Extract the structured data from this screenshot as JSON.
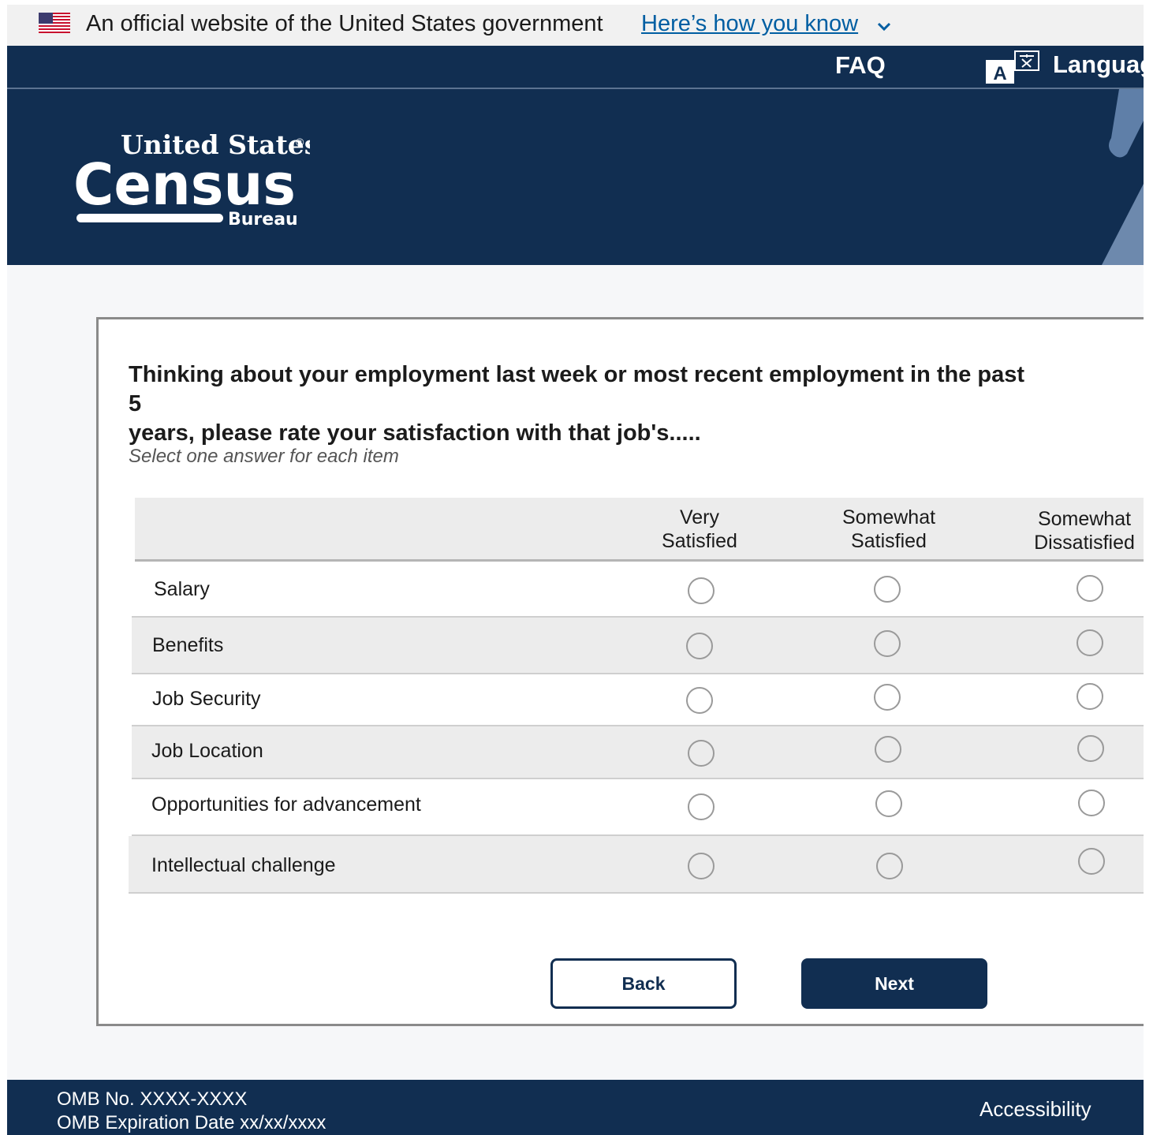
{
  "gov_banner": {
    "text": "An official website of the United States government",
    "link": "Here’s how you know"
  },
  "nav": {
    "faq": "FAQ",
    "language": "Language",
    "language_icon_letter": "A"
  },
  "logo": {
    "line1": "United States",
    "registered": "®",
    "line2": "Census",
    "line3": "Bureau"
  },
  "colors": {
    "navy": "#112e51",
    "link": "#005ea2",
    "row_alt": "#ececec"
  },
  "survey": {
    "question_line1": "Thinking about your employment last week or most recent employment in the past 5",
    "question_line2": "years, please rate your satisfaction with that job's.....",
    "instruction": "Select one answer for each item",
    "columns": [
      {
        "line1": "Very",
        "line2": "Satisfied"
      },
      {
        "line1": "Somewhat",
        "line2": "Satisfied"
      },
      {
        "line1": "Somewhat",
        "line2": "Dissatisfied"
      }
    ],
    "rows": [
      {
        "label": "Salary"
      },
      {
        "label": "Benefits"
      },
      {
        "label": "Job Security"
      },
      {
        "label": "Job Location"
      },
      {
        "label": "Opportunities for advancement"
      },
      {
        "label": "Intellectual challenge"
      }
    ]
  },
  "buttons": {
    "back": "Back",
    "next": "Next"
  },
  "footer": {
    "omb_number": "OMB No. XXXX-XXXX",
    "omb_expiration": "OMB Expiration Date xx/xx/xxxx",
    "accessibility": "Accessibility"
  }
}
